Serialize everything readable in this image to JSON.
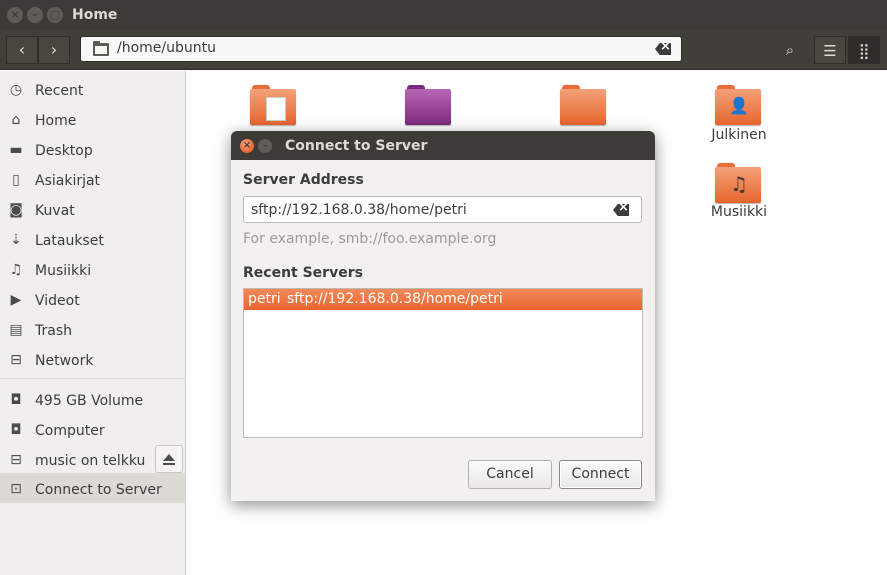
{
  "window": {
    "title": "Home",
    "close": "×",
    "minimize": "–",
    "maximize": "□"
  },
  "toolbar": {
    "back_glyph": "‹",
    "forward_glyph": "›",
    "path": "/home/ubuntu",
    "search_glyph": "⌕",
    "list_glyph": "☰",
    "grid_glyph": "⣿"
  },
  "sidebar": {
    "places": [
      {
        "label": "Recent",
        "icon": "clock-icon",
        "glyph": "◷"
      },
      {
        "label": "Home",
        "icon": "home-icon",
        "glyph": "⌂"
      },
      {
        "label": "Desktop",
        "icon": "folder-icon",
        "glyph": "▬"
      },
      {
        "label": "Asiakirjat",
        "icon": "document-icon",
        "glyph": "▯"
      },
      {
        "label": "Kuvat",
        "icon": "camera-icon",
        "glyph": "◙"
      },
      {
        "label": "Lataukset",
        "icon": "download-icon",
        "glyph": "⇣"
      },
      {
        "label": "Musiikki",
        "icon": "music-icon",
        "glyph": "♫"
      },
      {
        "label": "Videot",
        "icon": "video-icon",
        "glyph": "▶"
      },
      {
        "label": "Trash",
        "icon": "trash-icon",
        "glyph": "▤"
      },
      {
        "label": "Network",
        "icon": "network-icon",
        "glyph": "⊟"
      }
    ],
    "devices": [
      {
        "label": "495 GB Volume",
        "icon": "drive-icon",
        "glyph": "◘"
      },
      {
        "label": "Computer",
        "icon": "computer-icon",
        "glyph": "◘"
      },
      {
        "label": "music on telkku",
        "icon": "network-share-icon",
        "glyph": "⊟"
      },
      {
        "label": "Connect to Server",
        "icon": "server-icon",
        "glyph": "⊡"
      }
    ]
  },
  "content": {
    "items": [
      {
        "label": "Julkinen",
        "icon": "public-folder-icon",
        "glyph": "👤"
      },
      {
        "label": "Musiikki",
        "icon": "music-folder-icon",
        "glyph": "♫"
      }
    ]
  },
  "dialog": {
    "title": "Connect to Server",
    "close": "×",
    "minimize": "–",
    "server_address_label": "Server Address",
    "server_address_value": "sftp://192.168.0.38/home/petri",
    "hint": "For example, smb://foo.example.org",
    "recent_label": "Recent Servers",
    "recent_servers": [
      {
        "name": "petri",
        "uri": "sftp://192.168.0.38/home/petri"
      }
    ],
    "cancel_label": "Cancel",
    "connect_label": "Connect"
  },
  "colors": {
    "accent": "#e9642d",
    "titlebar": "#3c3b37",
    "sidebar_bg": "#f0efed"
  }
}
